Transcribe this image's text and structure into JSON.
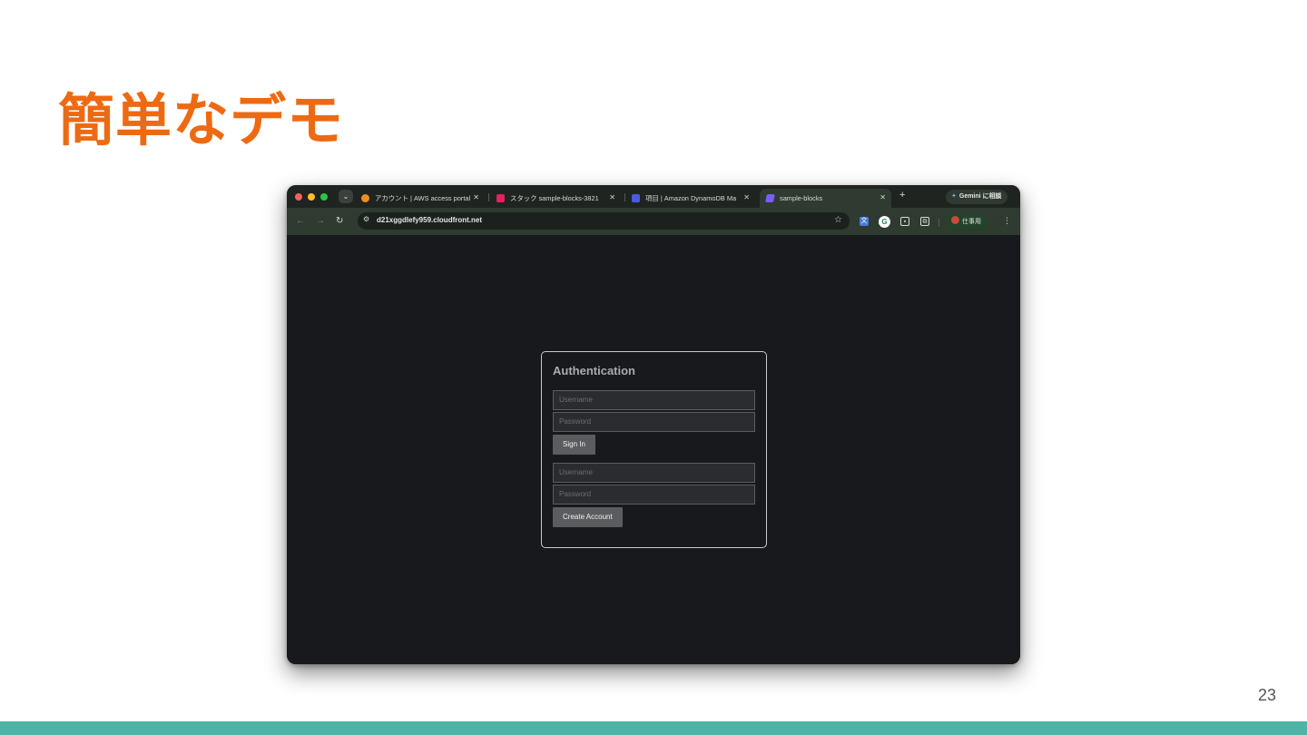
{
  "slide": {
    "title": "簡単なデモ",
    "page_number": "23"
  },
  "browser": {
    "tabs": [
      {
        "label": "アカウント | AWS access portal",
        "favicon": "aws-cube-icon",
        "color": "#f08c1f"
      },
      {
        "label": "スタック sample-blocks-3821",
        "favicon": "cloudformation-icon",
        "color": "#e0245e"
      },
      {
        "label": "項目 | Amazon DynamoDB Ma",
        "favicon": "dynamodb-icon",
        "color": "#4a5bdc"
      },
      {
        "label": "sample-blocks",
        "favicon": "amplify-icon",
        "color": "#7b5cff",
        "active": true
      }
    ],
    "new_tab": "+",
    "gemini_label": "Gemini に相談",
    "url": "d21xggdlefy959.cloudfront.net",
    "profile_label": "仕事用"
  },
  "auth": {
    "title": "Authentication",
    "signin": {
      "username_placeholder": "Username",
      "password_placeholder": "Password",
      "button_label": "Sign In"
    },
    "signup": {
      "username_placeholder": "Username",
      "password_placeholder": "Password",
      "button_label": "Create Account"
    }
  }
}
